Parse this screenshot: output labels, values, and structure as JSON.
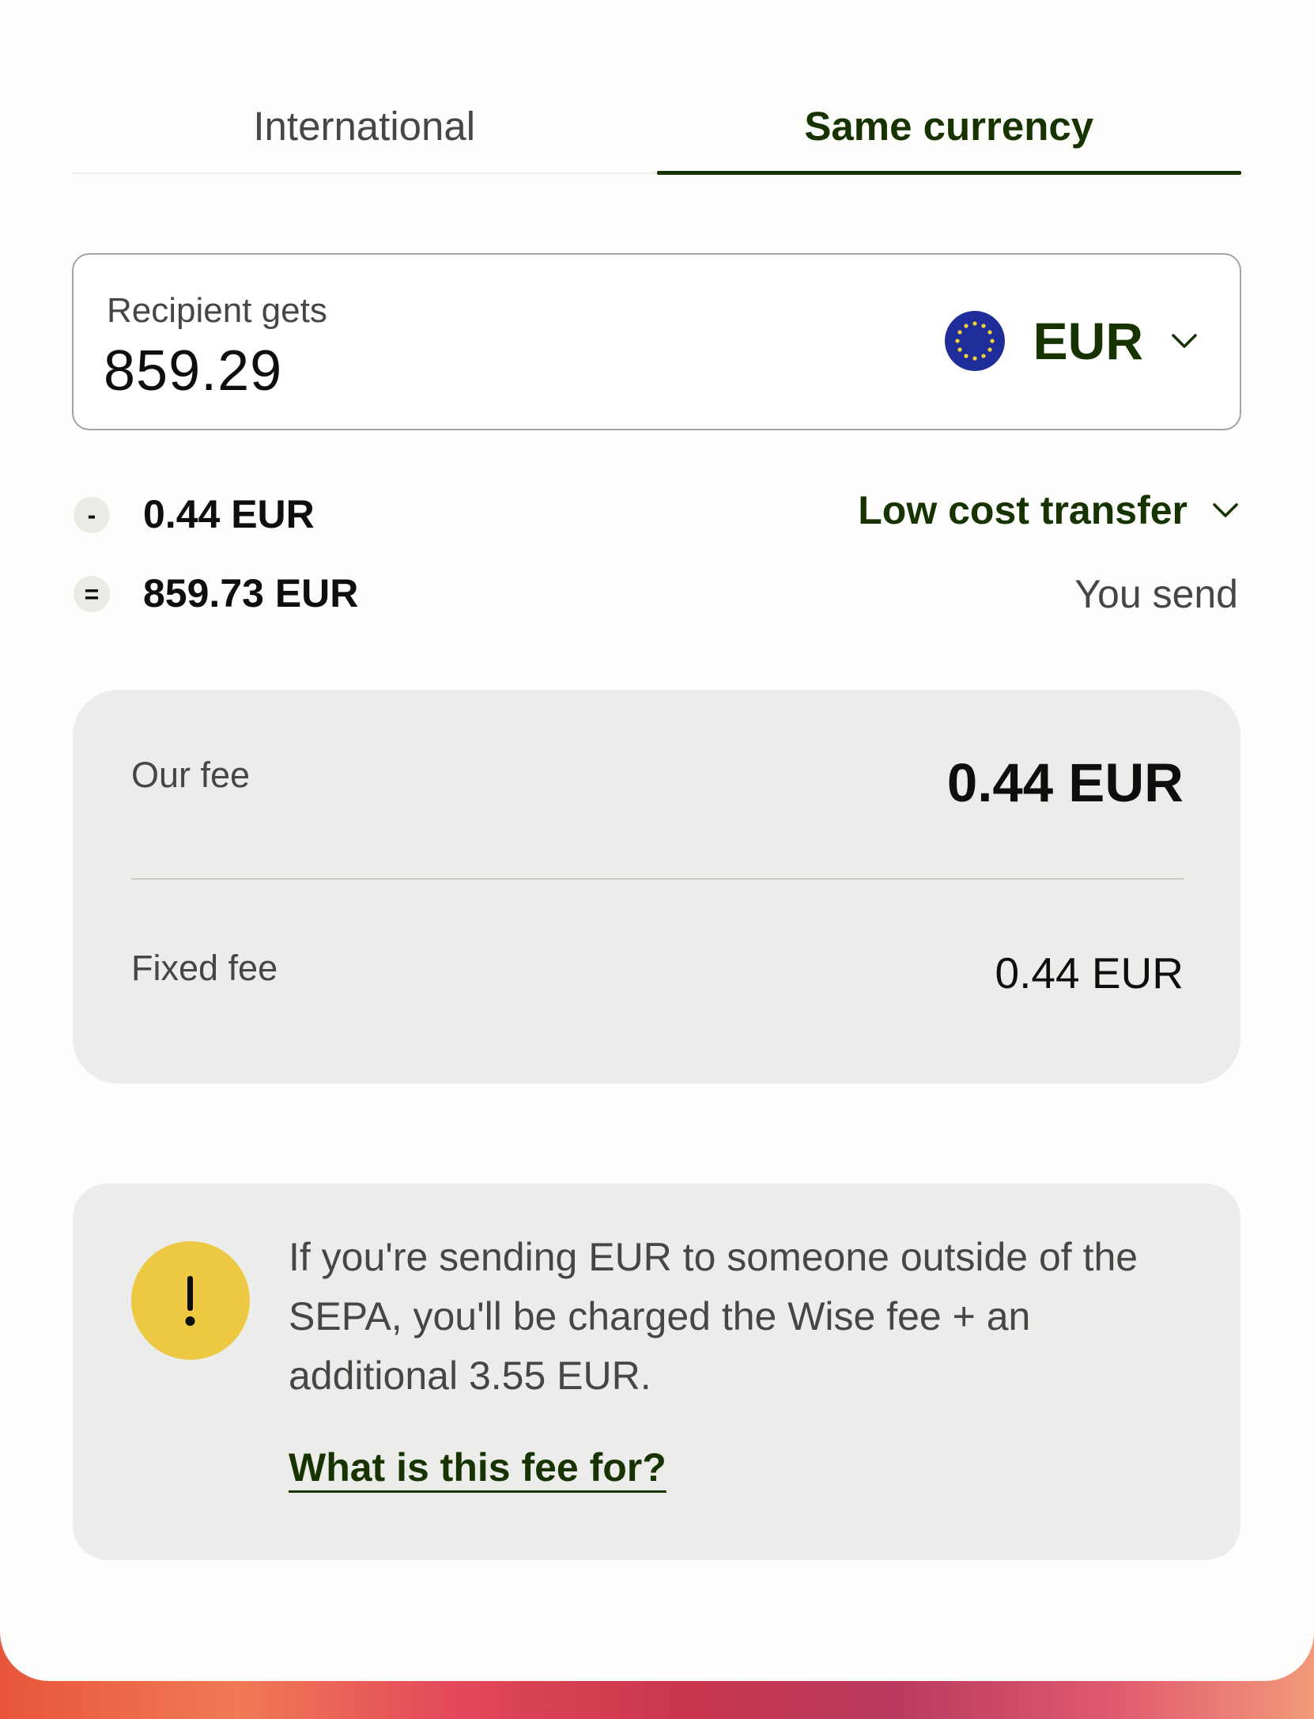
{
  "tabs": [
    {
      "label": "International",
      "active": false
    },
    {
      "label": "Same currency",
      "active": true
    }
  ],
  "recipient": {
    "label": "Recipient gets",
    "amount": "859.29",
    "currency": "EUR",
    "flag_icon": "eu-flag-icon"
  },
  "breakdown": {
    "fee_operator": "-",
    "fee_amount": "0.44 EUR",
    "transfer_type": "Low cost transfer",
    "total_operator": "=",
    "total_amount": "859.73 EUR",
    "total_label": "You send"
  },
  "fees": {
    "our_fee_label": "Our fee",
    "our_fee_value": "0.44 EUR",
    "fixed_fee_label": "Fixed fee",
    "fixed_fee_value": "0.44 EUR"
  },
  "notice": {
    "icon": "warning-icon",
    "text": "If you're sending EUR to someone outside of the SEPA, you'll be charged the Wise fee + an additional 3.55 EUR.",
    "link": "What is this fee for?"
  },
  "colors": {
    "accent": "#163300",
    "warning": "#edc843",
    "panel": "#ecedea"
  }
}
